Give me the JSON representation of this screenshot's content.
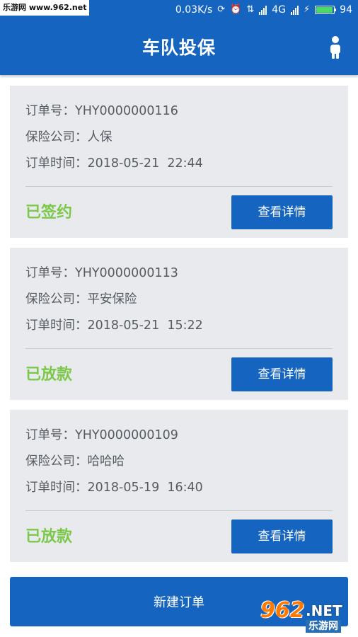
{
  "status_bar": {
    "watermark": "乐游网 www.962.net",
    "speed": "0.03K/s",
    "network": "4G",
    "battery": "94",
    "battery_level": 0.94
  },
  "header": {
    "title": "车队投保"
  },
  "orders": [
    {
      "order_no": "订单号：YHY0000000116",
      "company": "保险公司：人保",
      "time": "订单时间：2018-05-21  22:44",
      "status": "已签约",
      "button": "查看详情"
    },
    {
      "order_no": "订单号：YHY0000000113",
      "company": "保险公司：平安保险",
      "time": "订单时间：2018-05-21  15:22",
      "status": "已放款",
      "button": "查看详情"
    },
    {
      "order_no": "订单号：YHY0000000109",
      "company": "保险公司：哈哈哈",
      "time": "订单时间：2018-05-19  16:40",
      "status": "已放款",
      "button": "查看详情"
    }
  ],
  "footer": {
    "new_order": "新建订单"
  },
  "watermark_logo": {
    "number": "962",
    "suffix": ".NET",
    "site": "乐游网"
  },
  "colors": {
    "primary": "#1565c0",
    "status_green": "#7cc84a",
    "card_bg": "#e8eaed"
  },
  "icons": {
    "user": "user-icon",
    "alarm": "alarm-icon",
    "signal": "signal-icon",
    "charging": "charging-icon"
  }
}
